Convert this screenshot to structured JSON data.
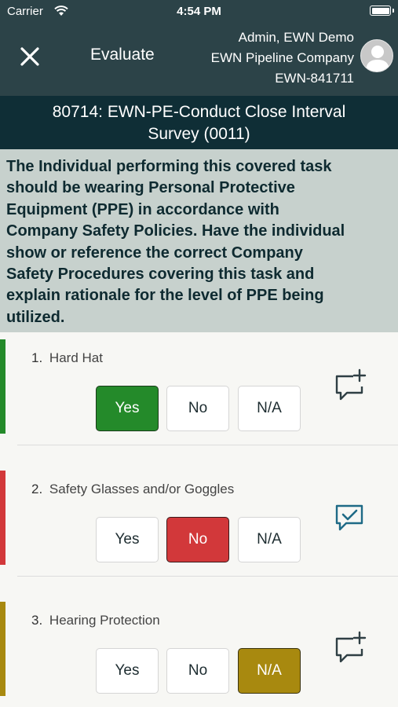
{
  "status_bar": {
    "carrier": "Carrier",
    "time": "4:54 PM"
  },
  "nav": {
    "title": "Evaluate",
    "user_line1": "Admin, EWN Demo",
    "user_line2": "EWN Pipeline Company",
    "user_line3": "EWN-841711"
  },
  "task": {
    "title_line1": "80714: EWN-PE-Conduct Close Interval",
    "title_line2": "Survey (0011)"
  },
  "instructions": {
    "lines": [
      "The Individual performing this covered task",
      "should be wearing Personal Protective",
      "Equipment (PPE) in accordance with",
      "Company Safety Policies. Have the individual",
      "show or reference the correct Company",
      "Safety Procedures covering this task and",
      "explain rationale for the level of PPE being",
      "utilized."
    ]
  },
  "options": {
    "yes": "Yes",
    "no": "No",
    "na": "N/A"
  },
  "items": [
    {
      "number": "1.",
      "label": "Hard Hat",
      "selected": "Yes",
      "status_color": "#248a2a",
      "comment_icon": "comment-add-icon"
    },
    {
      "number": "2.",
      "label": "Safety Glasses and/or Goggles",
      "selected": "No",
      "status_color": "#d2383a",
      "comment_icon": "comment-check-icon"
    },
    {
      "number": "3.",
      "label": "Hearing Protection",
      "selected": "N/A",
      "status_color": "#a8890f",
      "comment_icon": "comment-add-icon"
    }
  ],
  "colors": {
    "header_bg": "#2c4348",
    "title_bg": "#0f2e36",
    "instructions_bg": "#c7d1cd",
    "comment_check": "#1e6a86",
    "comment_add": "#2f3f44"
  }
}
